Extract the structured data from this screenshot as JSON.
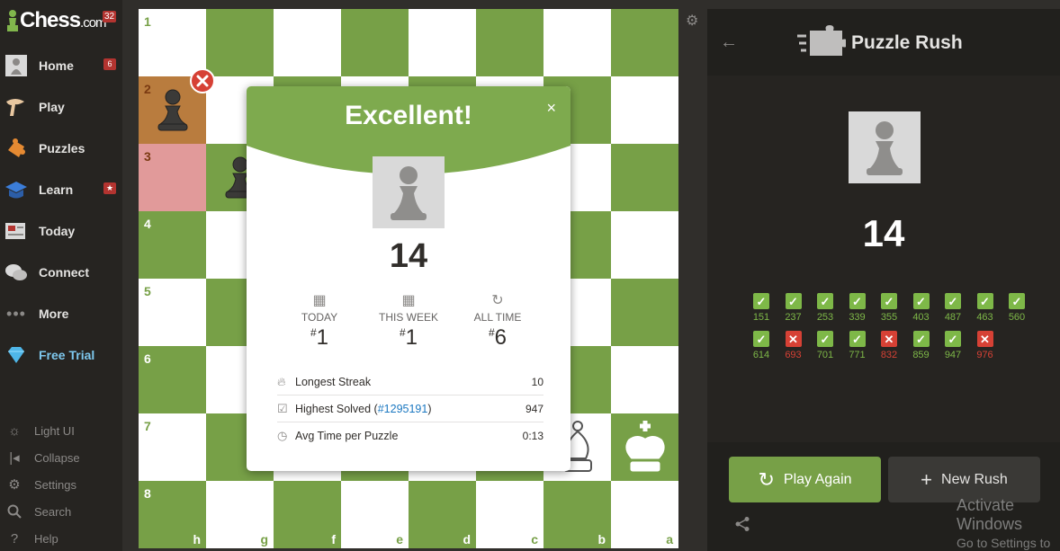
{
  "app": {
    "logo": "Chess",
    "logo_suffix": ".com",
    "logo_badge": "32"
  },
  "sidebar": {
    "items": [
      {
        "label": "Home",
        "badge": "6"
      },
      {
        "label": "Play"
      },
      {
        "label": "Puzzles"
      },
      {
        "label": "Learn",
        "badge": "★"
      },
      {
        "label": "Today"
      },
      {
        "label": "Connect"
      },
      {
        "label": "More"
      },
      {
        "label": "Free Trial"
      }
    ],
    "bottom": [
      {
        "label": "Light UI"
      },
      {
        "label": "Collapse"
      },
      {
        "label": "Settings"
      },
      {
        "label": "Search"
      },
      {
        "label": "Help"
      }
    ]
  },
  "board": {
    "ranks": [
      "1",
      "2",
      "3",
      "4",
      "5",
      "6",
      "7",
      "8"
    ],
    "files": [
      "h",
      "g",
      "f",
      "e",
      "d",
      "c",
      "b",
      "a"
    ]
  },
  "modal": {
    "title": "Excellent!",
    "close": "×",
    "score": "14",
    "ranks": [
      {
        "label": "TODAY",
        "value": "1"
      },
      {
        "label": "THIS WEEK",
        "value": "1"
      },
      {
        "label": "ALL TIME",
        "value": "6"
      }
    ],
    "rank_prefix": "#",
    "stats": {
      "streak_label": "Longest Streak",
      "streak_value": "10",
      "highest_label": "Highest Solved (",
      "highest_link": "#1295191",
      "highest_close": ")",
      "highest_value": "947",
      "avg_label": "Avg Time per Puzzle",
      "avg_value": "0:13"
    }
  },
  "panel": {
    "title": "Puzzle Rush",
    "score": "14",
    "results": [
      {
        "num": "151",
        "ok": true
      },
      {
        "num": "237",
        "ok": true
      },
      {
        "num": "253",
        "ok": true
      },
      {
        "num": "339",
        "ok": true
      },
      {
        "num": "355",
        "ok": true
      },
      {
        "num": "403",
        "ok": true
      },
      {
        "num": "487",
        "ok": true
      },
      {
        "num": "463",
        "ok": true
      },
      {
        "num": "560",
        "ok": true
      },
      {
        "num": "614",
        "ok": true
      },
      {
        "num": "693",
        "ok": false
      },
      {
        "num": "701",
        "ok": true
      },
      {
        "num": "771",
        "ok": true
      },
      {
        "num": "832",
        "ok": false
      },
      {
        "num": "859",
        "ok": true
      },
      {
        "num": "947",
        "ok": true
      },
      {
        "num": "976",
        "ok": false
      }
    ],
    "play_again": "Play Again",
    "new_rush": "New Rush",
    "watermark1": "Activate Windows",
    "watermark2": "Go to Settings to activate Windows."
  },
  "colors": {
    "board_dark": "#77a047",
    "board_light": "#ffffff",
    "accent_green": "#7eb848",
    "error_red": "#d64135",
    "highlight_red": "#e19a9a",
    "highlight_orange": "#b97c3e"
  }
}
